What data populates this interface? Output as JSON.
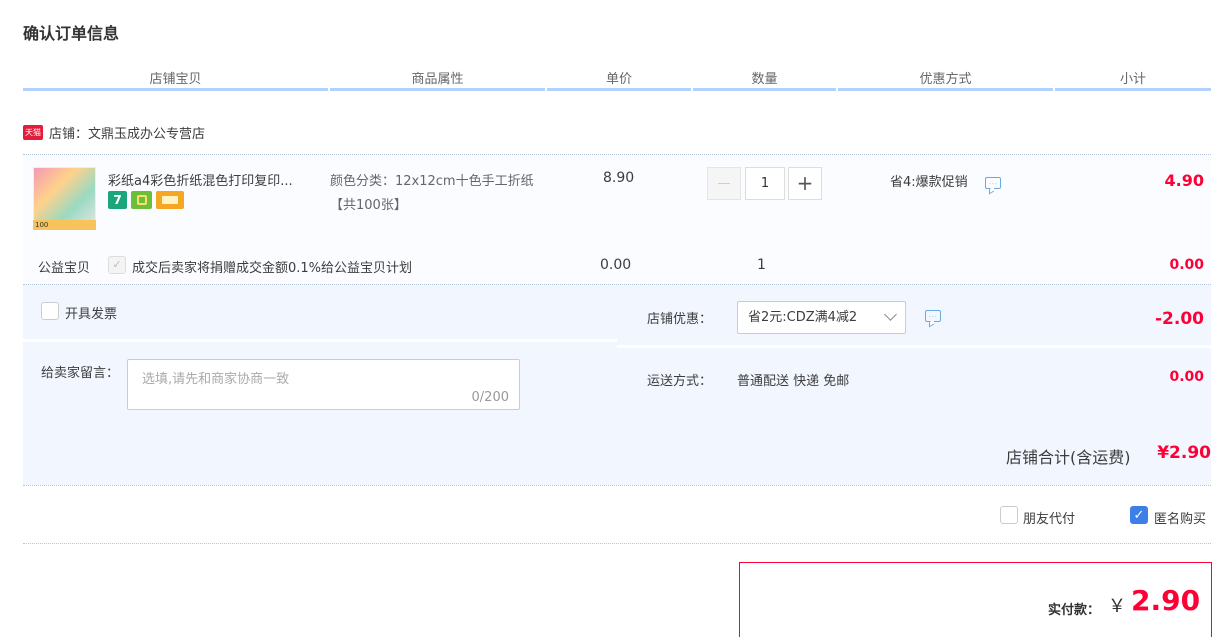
{
  "page": {
    "title": "确认订单信息"
  },
  "columns": [
    "店铺宝贝",
    "商品属性",
    "单价",
    "数量",
    "优惠方式",
    "小计"
  ],
  "shop": {
    "badge": "天猫",
    "label": "店铺：文鼎玉成办公专营店"
  },
  "item": {
    "name": "彩纸a4彩色折纸混色打印复印...",
    "thumb_caption": "100",
    "badges": [
      "7",
      "",
      ""
    ],
    "attribute": "颜色分类：12x12cm十色手工折纸【共100张】",
    "price": "8.90",
    "quantity": "1",
    "qty_minus": "—",
    "qty_plus": "+",
    "promo": "省4:爆款促销",
    "subtotal": "4.90"
  },
  "charity": {
    "label": "公益宝贝",
    "check_mark": "✓",
    "text": "成交后卖家将捐赠成交金额0.1%给公益宝贝计划",
    "price": "0.00",
    "quantity": "1",
    "subtotal": "0.00"
  },
  "options": {
    "invoice_label": "开具发票",
    "message_label": "给卖家留言：",
    "message_placeholder": "选填,请先和商家协商一致",
    "message_count": "0/200",
    "shop_discount_label": "店铺优惠：",
    "shop_discount_value": "省2元:CDZ满4减2",
    "shop_discount_amount": "-2.00",
    "shipping_label": "运送方式：",
    "shipping_value": "普通配送 快递 免邮",
    "shipping_amount": "0.00"
  },
  "totals": {
    "shop_total_label": "店铺合计(含运费)",
    "shop_total_amount": "¥2.90"
  },
  "extras": {
    "friend_pay_label": "朋友代付",
    "anonymous_label": "匿名购买",
    "anonymous_checked": true,
    "check_mark": "✓"
  },
  "payment": {
    "label": "实付款：",
    "currency": "￥",
    "amount": "2.90"
  },
  "colors": {
    "accent_red": "#ff0036",
    "header_bar": "#b2d1ff",
    "panel_bg": "#f2f7ff",
    "check_blue": "#3d7fe8"
  }
}
